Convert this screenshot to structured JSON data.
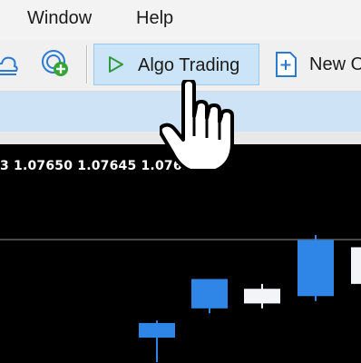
{
  "menu": {
    "window_label": "Window",
    "help_label": "Help"
  },
  "toolbar": {
    "algo_trading_label": "Algo Trading",
    "new_order_label": "New O",
    "icons": [
      "cloud-icon",
      "signals-icon",
      "play-icon",
      "new-order-icon"
    ],
    "accent_color": "#cce4f7"
  },
  "chart": {
    "quote_text": "3 1.07650 1.07645 1.07650",
    "background_color": "#000000",
    "bull_color": "#2f86e6",
    "bear_color": "#f2f4f8"
  },
  "chart_data": {
    "type": "candlestick",
    "candles": [
      {
        "open": 1.0764,
        "high": 1.07647,
        "low": 1.0763,
        "close": 1.07646,
        "color": "bull"
      },
      {
        "open": 1.07652,
        "high": 1.0766,
        "low": 1.0765,
        "close": 1.07664,
        "color": "bull"
      },
      {
        "open": 1.0766,
        "high": 1.07662,
        "low": 1.07652,
        "close": 1.07654,
        "color": "bear"
      },
      {
        "open": 1.07657,
        "high": 1.07682,
        "low": 1.07655,
        "close": 1.0768,
        "color": "bull"
      },
      {
        "open": 1.07677,
        "high": 1.0768,
        "low": 1.0766,
        "close": 1.07662,
        "color": "bear"
      }
    ]
  }
}
